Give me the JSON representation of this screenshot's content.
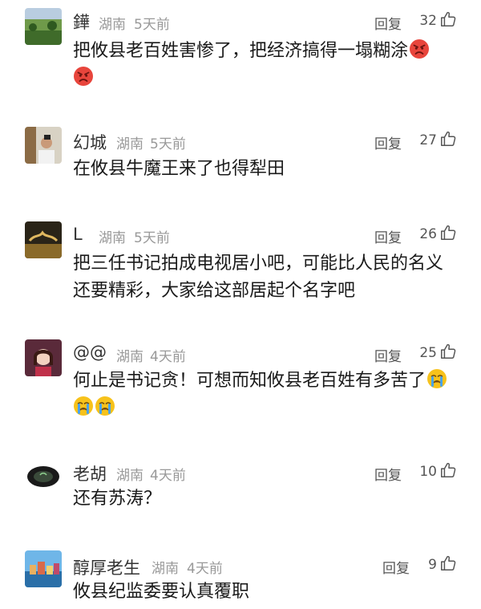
{
  "comments": [
    {
      "user": "鏵",
      "location": "湖南",
      "time": "5天前",
      "reply_label": "回复",
      "likes": "32",
      "text": "把攸县老百姓害惨了，把经济搞得一塌糊涂",
      "emojis": [
        "angry-face",
        "angry-face"
      ]
    },
    {
      "user": "幻城",
      "location": "湖南",
      "time": "5天前",
      "reply_label": "回复",
      "likes": "27",
      "text": "在攸县牛魔王来了也得犁田",
      "emojis": []
    },
    {
      "user": "L",
      "location": "湖南",
      "time": "5天前",
      "reply_label": "回复",
      "likes": "26",
      "text_line1": "把三任书记拍成电视居小吧，可能比人民的名义",
      "text_line2": "还要精彩，大家给这部居起个名字吧",
      "emojis": []
    },
    {
      "user": "@@",
      "location": "湖南",
      "time": "4天前",
      "reply_label": "回复",
      "likes": "25",
      "text": "何止是书记贪！可想而知攸县老百姓有多苦了",
      "emojis": [
        "crying-face",
        "crying-face",
        "crying-face"
      ]
    },
    {
      "user": "老胡",
      "location": "湖南",
      "time": "4天前",
      "reply_label": "回复",
      "likes": "10",
      "text": "还有苏涛？",
      "emojis": []
    },
    {
      "user": "醇厚老生",
      "location": "湖南",
      "time": "4天前",
      "reply_label": "回复",
      "likes": "9",
      "text": "攸县纪监委要认真覆职",
      "emojis": []
    }
  ],
  "colors": {
    "angry": "#e8453c",
    "crying_face": "#f7c21b",
    "tears": "#4aa3f0"
  }
}
